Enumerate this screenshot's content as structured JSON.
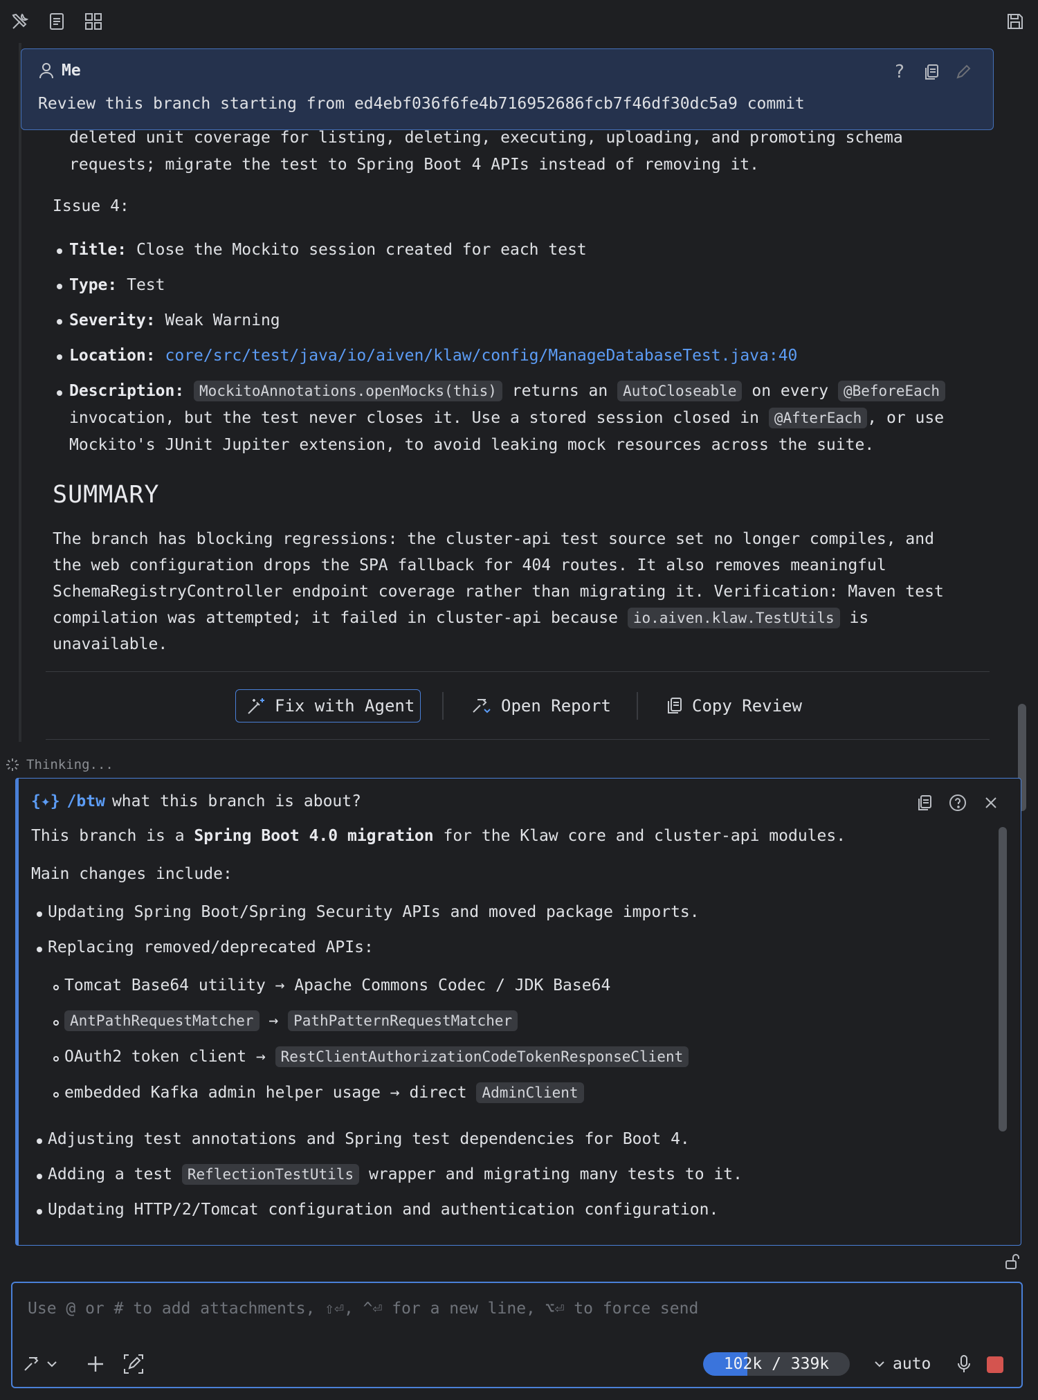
{
  "toolbar": {
    "left_icons": [
      "tools-icon",
      "document-icon",
      "grid-icon"
    ],
    "right_icons": [
      "save-icon"
    ]
  },
  "user_message": {
    "author": "Me",
    "text": "Review this branch starting from ed4ebf036f6fe4b716952686fcb7f46df30dc5a9 commit"
  },
  "review": {
    "carry_line1": "deleted unit coverage for listing, deleting, executing, uploading, and promoting schema",
    "carry_line2": "requests; migrate the test to Spring Boot 4 APIs instead of removing it.",
    "issue_heading": "Issue 4:",
    "title_label": "Title:",
    "title_value": "Close the Mockito session created for each test",
    "type_label": "Type:",
    "type_value": "Test",
    "severity_label": "Severity:",
    "severity_value": "Weak Warning",
    "location_label": "Location:",
    "location_value": "core/src/test/java/io/aiven/klaw/config/ManageDatabaseTest.java:40",
    "description_label": "Description:",
    "desc_code1": "MockitoAnnotations.openMocks(this)",
    "desc_t1": "returns an",
    "desc_code2": "AutoCloseable",
    "desc_t2": "on every",
    "desc_code3": "@BeforeEach",
    "desc_line2a": "invocation, but the test never closes it. Use a stored session closed in",
    "desc_code4": "@AfterEach",
    "desc_line2b": ", or use",
    "desc_line3": "Mockito's JUnit Jupiter extension, to avoid leaking mock resources across the suite.",
    "summary_title": "SUMMARY",
    "summary_l1": "The branch has blocking regressions: the cluster-api test source set no longer compiles, and",
    "summary_l2": "the web configuration drops the SPA fallback for 404 routes. It also removes meaningful",
    "summary_l3": "SchemaRegistryController endpoint coverage rather than migrating it. Verification: Maven test",
    "summary_l4a": "compilation was attempted; it failed in cluster-api because",
    "summary_code": "io.aiven.klaw.TestUtils",
    "summary_l4b": "is",
    "summary_l5": "unavailable."
  },
  "actions": {
    "fix": "Fix with Agent",
    "open": "Open Report",
    "copy": "Copy Review"
  },
  "status": {
    "thinking": "Thinking..."
  },
  "btw": {
    "command": "/btw",
    "question": "what this branch is about?",
    "intro_a": "This branch is a",
    "intro_bold": "Spring Boot 4.0 migration",
    "intro_b": "for the Klaw core and cluster-api modules.",
    "main_changes": "Main changes include:",
    "item1": "Updating Spring Boot/Spring Security APIs and moved package imports.",
    "item2": "Replacing removed/deprecated APIs:",
    "sub1": "Tomcat Base64 utility → Apache Commons Codec / JDK Base64",
    "sub2_code1": "AntPathRequestMatcher",
    "sub2_arrow": "→",
    "sub2_code2": "PathPatternRequestMatcher",
    "sub3_text": "OAuth2 token client →",
    "sub3_code": "RestClientAuthorizationCodeTokenResponseClient",
    "sub4_text": "embedded Kafka admin helper usage → direct",
    "sub4_code": "AdminClient",
    "item3": "Adjusting test annotations and Spring test dependencies for Boot 4.",
    "item4_a": "Adding a test",
    "item4_code": "ReflectionTestUtils",
    "item4_b": "wrapper and migrating many tests to it.",
    "item5": "Updating HTTP/2/Tomcat configuration and authentication configuration."
  },
  "input": {
    "placeholder": "Use @ or # to add attachments, ⇧⏎, ^⏎ for a new line, ⌥⏎ to force send",
    "usage": "102k / 339k",
    "usage_fraction": 0.301,
    "mode": "auto"
  },
  "colors": {
    "accent": "#4a80d8",
    "link": "#5c9cf5",
    "stop": "#d4544f"
  }
}
